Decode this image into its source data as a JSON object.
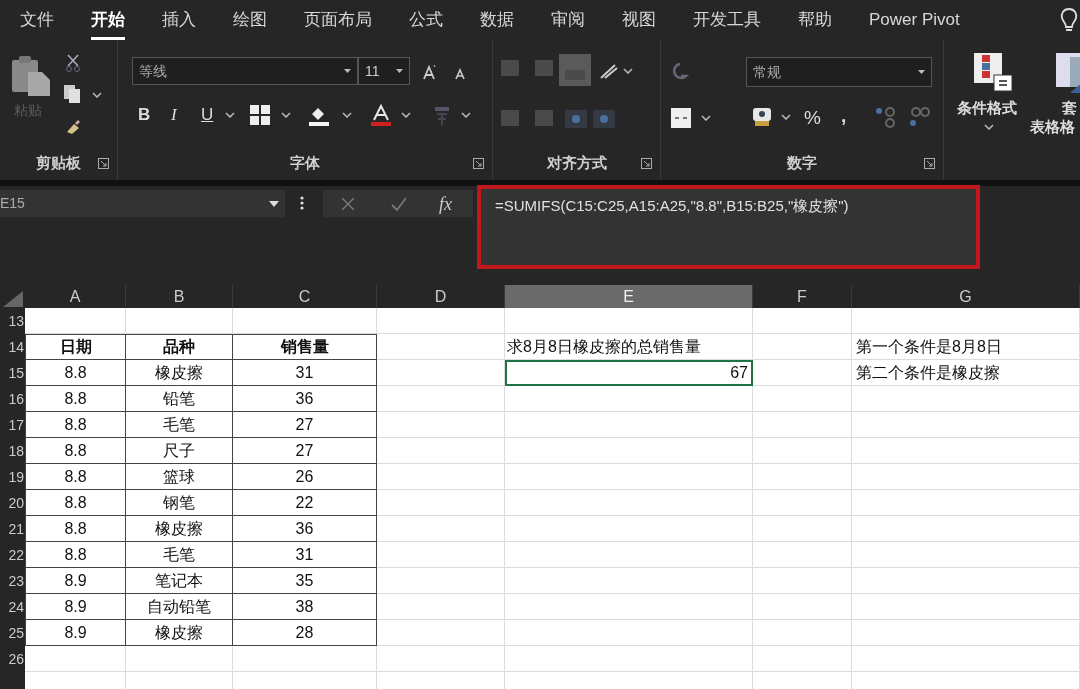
{
  "tabs": [
    {
      "label": "文件",
      "selected": false
    },
    {
      "label": "开始",
      "selected": true
    },
    {
      "label": "插入",
      "selected": false
    },
    {
      "label": "绘图",
      "selected": false
    },
    {
      "label": "页面布局",
      "selected": false
    },
    {
      "label": "公式",
      "selected": false
    },
    {
      "label": "数据",
      "selected": false
    },
    {
      "label": "审阅",
      "selected": false
    },
    {
      "label": "视图",
      "selected": false
    },
    {
      "label": "开发工具",
      "selected": false
    },
    {
      "label": "帮助",
      "selected": false
    },
    {
      "label": "Power Pivot",
      "selected": false
    }
  ],
  "ribbon": {
    "clipboard": {
      "label": "剪贴板",
      "paste_label": "粘贴",
      "paste_disabled": true
    },
    "font": {
      "label": "字体",
      "font_name": "等线",
      "font_size": "11",
      "bold": "B",
      "italic": "I",
      "underline": "U"
    },
    "alignment": {
      "label": "对齐方式"
    },
    "number": {
      "label": "数字",
      "format": "常规",
      "percent": "%",
      "comma": ","
    },
    "styles": {
      "conditional_format": "条件格式",
      "table_format_line1": "套",
      "table_format_line2": "表格格"
    }
  },
  "formula_bar": {
    "name_box": "E15",
    "function_button": "fx",
    "formula": "=SUMIFS(C15:C25,A15:A25,\"8.8\",B15:B25,\"橡皮擦\")",
    "highlighted": true
  },
  "sheet": {
    "columns": [
      {
        "label": "A",
        "selected": false
      },
      {
        "label": "B",
        "selected": false
      },
      {
        "label": "C",
        "selected": false
      },
      {
        "label": "D",
        "selected": false
      },
      {
        "label": "E",
        "selected": true
      },
      {
        "label": "F",
        "selected": false
      },
      {
        "label": "G",
        "selected": false
      }
    ],
    "row_headers": [
      "13",
      "14",
      "15",
      "16",
      "17",
      "18",
      "19",
      "20",
      "21",
      "22",
      "23",
      "24",
      "25",
      "26"
    ],
    "data_table": {
      "header": [
        "日期",
        "品种",
        "销售量"
      ],
      "rows": [
        [
          "8.8",
          "橡皮擦",
          "31"
        ],
        [
          "8.8",
          "铅笔",
          "36"
        ],
        [
          "8.8",
          "毛笔",
          "27"
        ],
        [
          "8.8",
          "尺子",
          "27"
        ],
        [
          "8.8",
          "篮球",
          "26"
        ],
        [
          "8.8",
          "钢笔",
          "22"
        ],
        [
          "8.8",
          "橡皮擦",
          "36"
        ],
        [
          "8.8",
          "毛笔",
          "31"
        ],
        [
          "8.9",
          "笔记本",
          "35"
        ],
        [
          "8.9",
          "自动铅笔",
          "38"
        ],
        [
          "8.9",
          "橡皮擦",
          "28"
        ]
      ]
    },
    "question": "求8月8日橡皮擦的总销售量",
    "result": {
      "text": "67",
      "selected": true
    },
    "notes": [
      "第一个条件是8月8日",
      "第二个条件是橡皮擦"
    ]
  }
}
